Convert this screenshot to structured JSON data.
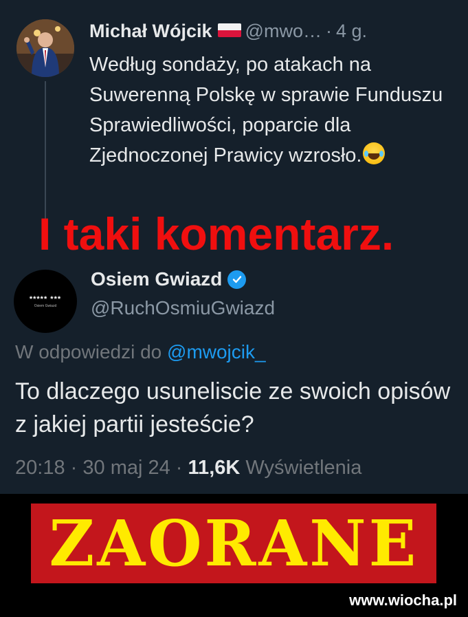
{
  "tweet1": {
    "author_name": "Michał Wójcik",
    "flag_icon": "poland-flag-icon",
    "handle": "@mwo…",
    "separator": "·",
    "time": "4 g.",
    "text_main": "Według sondaży, po atakach na Suwerenną Polskę w sprawie Funduszu Sprawiedliwości, poparcie dla Zjednoczonej Prawicy wzrosło.",
    "emoji": "laughing-tears-emoji"
  },
  "overlay": {
    "comment": "I taki komentarz."
  },
  "tweet2": {
    "avatar_text": "***** ***",
    "avatar_subtext": "Osiem Gwiazd",
    "author_name": "Osiem Gwiazd",
    "verified_icon": "verified-badge-icon",
    "handle": "@RuchOsmiuGwiazd",
    "reply_prefix": "W odpowiedzi do",
    "reply_mention": "@mwojcik_",
    "text": "To dlaczego usuneliscie ze swoich opisów z jakiej partii jesteście?",
    "time": "20:18",
    "date": "30 maj 24",
    "dot": "·",
    "views_count": "11,6K",
    "views_label": "Wyświetlenia"
  },
  "banner": {
    "text": "ZAORANE",
    "bg_color": "#c3161c",
    "text_color": "#ffea00"
  },
  "watermark": {
    "text": "www.wiocha.pl"
  }
}
